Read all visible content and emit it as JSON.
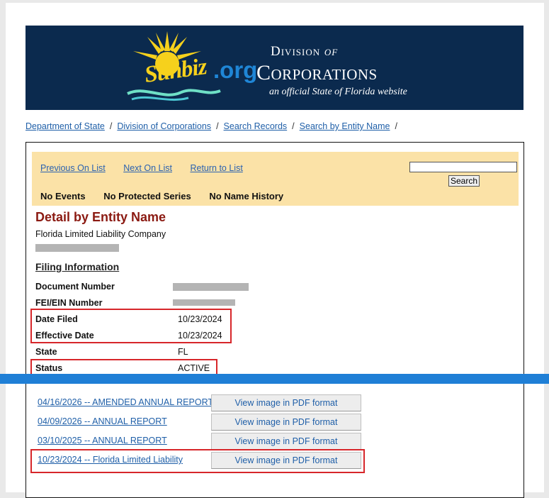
{
  "banner": {
    "logo_word": "Sunbiz",
    "logo_org": ".org",
    "division_of": "Division",
    "of": "of",
    "corporations": "Corporations",
    "tagline": "an official State of Florida website"
  },
  "breadcrumb": {
    "items": [
      "Department of State",
      "Division of Corporations",
      "Search Records",
      "Search by Entity Name"
    ],
    "separator": "/"
  },
  "nav": {
    "previous": "Previous On List",
    "next": "Next On List",
    "return": "Return to List",
    "search_button": "Search",
    "search_value": ""
  },
  "events": {
    "no_events": "No Events",
    "no_protected": "No Protected Series",
    "no_name_history": "No Name History"
  },
  "detail": {
    "title": "Detail by Entity Name",
    "entity_type": "Florida Limited Liability Company"
  },
  "filing": {
    "heading": "Filing Information",
    "labels": {
      "document_number": "Document Number",
      "fei_ein": "FEI/EIN Number",
      "date_filed": "Date Filed",
      "effective_date": "Effective Date",
      "state": "State",
      "status": "Status"
    },
    "values": {
      "date_filed": "10/23/2024",
      "effective_date": "10/23/2024",
      "state": "FL",
      "status": "ACTIVE"
    }
  },
  "documents": [
    {
      "label": "04/16/2026 -- AMENDED ANNUAL REPORT",
      "button": "View image in PDF format"
    },
    {
      "label": "04/09/2026 -- ANNUAL REPORT",
      "button": "View image in PDF format"
    },
    {
      "label": "03/10/2025 -- ANNUAL REPORT",
      "button": "View image in PDF format"
    },
    {
      "label": "10/23/2024 -- Florida Limited Liability",
      "button": "View image in PDF format"
    }
  ],
  "colors": {
    "banner_bg": "#0b2a4e",
    "nav_bg": "#fbe2a7",
    "title_red": "#8b1a12",
    "highlight_red": "#d7262a",
    "blue_band": "#1f7fd6",
    "link_blue": "#1f5fa8"
  }
}
